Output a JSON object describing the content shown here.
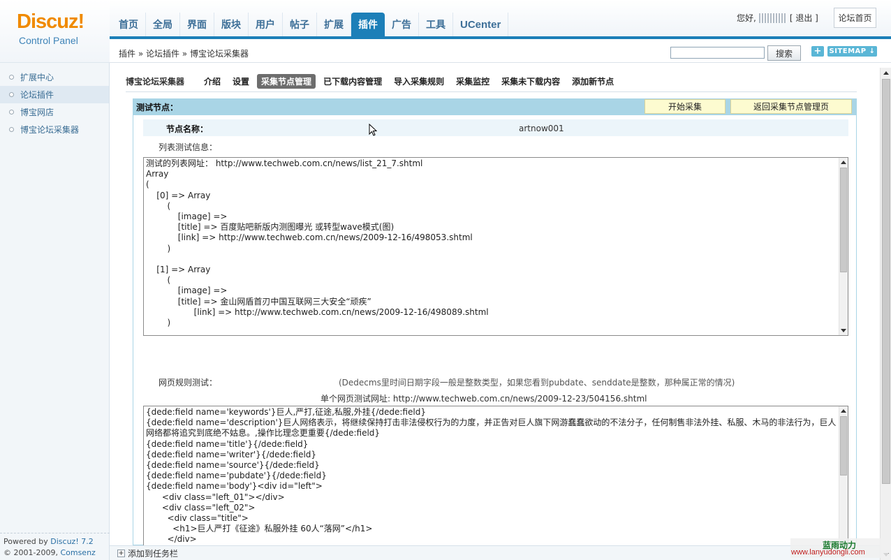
{
  "logo": {
    "main": "Discuz!",
    "sub": "Control Panel"
  },
  "top_nav": [
    {
      "label": "首页",
      "active": false
    },
    {
      "label": "全局",
      "active": false
    },
    {
      "label": "界面",
      "active": false
    },
    {
      "label": "版块",
      "active": false
    },
    {
      "label": "用户",
      "active": false
    },
    {
      "label": "帖子",
      "active": false
    },
    {
      "label": "扩展",
      "active": false
    },
    {
      "label": "插件",
      "active": true
    },
    {
      "label": "广告",
      "active": false
    },
    {
      "label": "工具",
      "active": false
    },
    {
      "label": "UCenter",
      "active": false
    }
  ],
  "user": {
    "greeting": "您好,",
    "logout": "[ 退出 ]",
    "home": "论坛首页"
  },
  "breadcrumb": "插件 » 论坛插件 » 博宝论坛采集器",
  "search": {
    "value": "",
    "button": "搜索"
  },
  "shortcut": {
    "plus": "+",
    "sitemap": "SITEMAP ↓"
  },
  "sidebar": {
    "items": [
      {
        "label": "扩展中心",
        "active": false
      },
      {
        "label": "论坛插件",
        "active": true
      },
      {
        "label": "博宝网店",
        "active": false
      },
      {
        "label": "博宝论坛采集器",
        "active": false
      }
    ],
    "powered_prefix": "Powered by ",
    "powered_brand": "Discuz! 7.2",
    "copyright_prefix": "© 2001-2009, ",
    "copyright_brand": "Comsenz Inc."
  },
  "plugin_nav": {
    "title": "博宝论坛采集器",
    "items": [
      {
        "label": "介绍",
        "active": false
      },
      {
        "label": "设置",
        "active": false
      },
      {
        "label": "采集节点管理",
        "active": true
      },
      {
        "label": "已下载内容管理",
        "active": false
      },
      {
        "label": "导入采集规则",
        "active": false
      },
      {
        "label": "采集监控",
        "active": false
      },
      {
        "label": "采集未下载内容",
        "active": false
      },
      {
        "label": "添加新节点",
        "active": false
      }
    ]
  },
  "panel": {
    "title": "测试节点：",
    "start_button": "开始采集",
    "back_button": "返回采集节点管理页",
    "node_name_label": "节点名称：",
    "node_name_value": "artnow001",
    "list_test_label": "列表测试信息：",
    "list_output": "测试的列表网址： http://www.techweb.com.cn/news/list_21_7.shtml\nArray\n(\n    [0] => Array\n        (\n            [image] => \n            [title] => 百度贴吧新版内测图曝光 或转型wave模式(图)\n            [link] => http://www.techweb.com.cn/news/2009-12-16/498053.shtml\n        )\n\n    [1] => Array\n        (\n            [image] => \n            [title] => 金山网盾首刃中国互联网三大安全“顽疾”\n                  [link] => http://www.techweb.com.cn/news/2009-12-16/498089.shtml\n        )",
    "rule_test_label": "网页规则测试：",
    "rule_note": "(Dedecms里时间日期字段一般是整数类型，如果您看到pubdate、senddate是整数，那种属正常的情况)",
    "single_url": "单个网页测试网址: http://www.techweb.com.cn/news/2009-12-23/504156.shtml",
    "rule_output": "{dede:field name='keywords'}巨人,严打,征途,私服,外挂{/dede:field}\n{dede:field name='description'}巨人网络表示，将继续保持打击非法侵权行为的力度，并正告对巨人旗下网游蠢蠢欲动的不法分子，任何制售非法外挂、私服、木马的非法行为，巨人网络都将追究到底绝不姑息。,操作比理念更重要{/dede:field}\n{dede:field name='title'}{/dede:field}\n{dede:field name='writer'}{/dede:field}\n{dede:field name='source'}{/dede:field}\n{dede:field name='pubdate'}{/dede:field}\n{dede:field name='body'}<div id=\"left\">\n      <div class=\"left_01\"></div>\n      <div class=\"left_02\">\n        <div class=\"title\">\n          <h1>巨人严打《征途》私服外挂 60人“落网”</h1>\n        </div>\n        <div class=\"title_line\"></div>\n        <div class=\"info\">\n          作者:乐天"
  },
  "taskbar": "添加到任务栏",
  "watermark": {
    "line1": "蓝雨动力",
    "line2": "www.lanyudongli.com"
  }
}
